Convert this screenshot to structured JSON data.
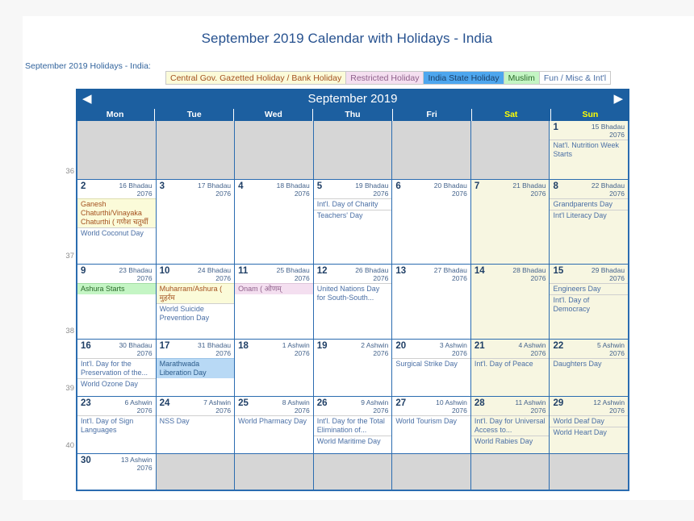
{
  "page": {
    "title": "September 2019 Calendar with Holidays - India",
    "holidays_label": "September 2019 Holidays - India:"
  },
  "legend": {
    "items": [
      {
        "label": "Central Gov. Gazetted Holiday / Bank Holiday",
        "key": "gazetted",
        "bg": "#fbfbd9",
        "fg": "#a4511f"
      },
      {
        "label": "Restricted Holiday",
        "key": "restricted",
        "bg": "#f4dff0",
        "fg": "#8e5f8a"
      },
      {
        "label": "India State Holiday",
        "key": "state",
        "bg": "#4da6ee",
        "fg": "#1b3f67"
      },
      {
        "label": "Muslim",
        "key": "muslim",
        "bg": "#c4f5c4",
        "fg": "#2a6b2a"
      },
      {
        "label": "Fun / Misc & Int'l",
        "key": "fun",
        "bg": "#ffffff",
        "fg": "#4a6fa5"
      }
    ]
  },
  "calendar": {
    "month_title": "September 2019",
    "prev_label": "◀",
    "next_label": "▶",
    "day_headers": [
      {
        "label": "Mon",
        "weekend": false
      },
      {
        "label": "Tue",
        "weekend": false
      },
      {
        "label": "Wed",
        "weekend": false
      },
      {
        "label": "Thu",
        "weekend": false
      },
      {
        "label": "Fri",
        "weekend": false
      },
      {
        "label": "Sat",
        "weekend": true
      },
      {
        "label": "Sun",
        "weekend": true
      }
    ],
    "week_numbers": [
      "36",
      "37",
      "38",
      "39",
      "40"
    ],
    "weeks": [
      {
        "number": "36",
        "days": [
          {
            "blank": true
          },
          {
            "blank": true
          },
          {
            "blank": true
          },
          {
            "blank": true
          },
          {
            "blank": true
          },
          {
            "blank": true
          },
          {
            "num": "1",
            "alt1": "15 Bhadau",
            "alt2": "2076",
            "weekend": true,
            "events": [
              {
                "text": "Nat'l. Nutrition Week Starts",
                "type": "fun"
              }
            ]
          }
        ]
      },
      {
        "number": "37",
        "days": [
          {
            "num": "2",
            "alt1": "16 Bhadau",
            "alt2": "2076",
            "weekend": false,
            "events": [
              {
                "text": "Ganesh Chaturthi/Vinayaka Chaturthi ( गणेश चतुर्थी",
                "type": "gazetted"
              },
              {
                "text": "World Coconut Day",
                "type": "fun"
              }
            ]
          },
          {
            "num": "3",
            "alt1": "17 Bhadau",
            "alt2": "2076",
            "weekend": false,
            "events": []
          },
          {
            "num": "4",
            "alt1": "18 Bhadau",
            "alt2": "2076",
            "weekend": false,
            "events": []
          },
          {
            "num": "5",
            "alt1": "19 Bhadau",
            "alt2": "2076",
            "weekend": false,
            "events": [
              {
                "text": "Int'l. Day of Charity",
                "type": "fun"
              },
              {
                "text": "Teachers' Day",
                "type": "fun"
              }
            ]
          },
          {
            "num": "6",
            "alt1": "20 Bhadau",
            "alt2": "2076",
            "weekend": false,
            "events": []
          },
          {
            "num": "7",
            "alt1": "21 Bhadau",
            "alt2": "2076",
            "weekend": true,
            "events": []
          },
          {
            "num": "8",
            "alt1": "22 Bhadau",
            "alt2": "2076",
            "weekend": true,
            "events": [
              {
                "text": "Grandparents Day",
                "type": "fun"
              },
              {
                "text": "Int'l Literacy Day",
                "type": "fun"
              }
            ]
          }
        ]
      },
      {
        "number": "38",
        "days": [
          {
            "num": "9",
            "alt1": "23 Bhadau",
            "alt2": "2076",
            "weekend": false,
            "events": [
              {
                "text": "Ashura Starts",
                "type": "muslim"
              }
            ]
          },
          {
            "num": "10",
            "alt1": "24 Bhadau",
            "alt2": "2076",
            "weekend": false,
            "events": [
              {
                "text": "Muharram/Ashura ( मुहर्रम",
                "type": "gazetted"
              },
              {
                "text": "World Suicide Prevention Day",
                "type": "fun"
              }
            ]
          },
          {
            "num": "11",
            "alt1": "25 Bhadau",
            "alt2": "2076",
            "weekend": false,
            "events": [
              {
                "text": "Onam ( ओणम्",
                "type": "restricted"
              }
            ]
          },
          {
            "num": "12",
            "alt1": "26 Bhadau",
            "alt2": "2076",
            "weekend": false,
            "events": [
              {
                "text": "United Nations Day for South-South...",
                "type": "fun"
              }
            ]
          },
          {
            "num": "13",
            "alt1": "27 Bhadau",
            "alt2": "2076",
            "weekend": false,
            "events": []
          },
          {
            "num": "14",
            "alt1": "28 Bhadau",
            "alt2": "2076",
            "weekend": true,
            "events": []
          },
          {
            "num": "15",
            "alt1": "29 Bhadau",
            "alt2": "2076",
            "weekend": true,
            "events": [
              {
                "text": "Engineers Day",
                "type": "fun"
              },
              {
                "text": "Int'l. Day of Democracy",
                "type": "fun"
              }
            ]
          }
        ]
      },
      {
        "number": "39",
        "days": [
          {
            "num": "16",
            "alt1": "30 Bhadau",
            "alt2": "2076",
            "weekend": false,
            "events": [
              {
                "text": "Int'l. Day for the Preservation of the...",
                "type": "fun"
              },
              {
                "text": "World Ozone Day",
                "type": "fun"
              }
            ]
          },
          {
            "num": "17",
            "alt1": "31 Bhadau",
            "alt2": "2076",
            "weekend": false,
            "events": [
              {
                "text": "Marathwada Liberation Day",
                "type": "state"
              }
            ]
          },
          {
            "num": "18",
            "alt1": "1 Ashwin",
            "alt2": "2076",
            "weekend": false,
            "events": []
          },
          {
            "num": "19",
            "alt1": "2 Ashwin",
            "alt2": "2076",
            "weekend": false,
            "events": []
          },
          {
            "num": "20",
            "alt1": "3 Ashwin",
            "alt2": "2076",
            "weekend": false,
            "events": [
              {
                "text": "Surgical Strike Day",
                "type": "fun"
              }
            ]
          },
          {
            "num": "21",
            "alt1": "4 Ashwin",
            "alt2": "2076",
            "weekend": true,
            "events": [
              {
                "text": "Int'l. Day of Peace",
                "type": "fun"
              }
            ]
          },
          {
            "num": "22",
            "alt1": "5 Ashwin",
            "alt2": "2076",
            "weekend": true,
            "events": [
              {
                "text": "Daughters Day",
                "type": "fun"
              }
            ]
          }
        ]
      },
      {
        "number": "40",
        "days": [
          {
            "num": "23",
            "alt1": "6 Ashwin",
            "alt2": "2076",
            "weekend": false,
            "events": [
              {
                "text": "Int'l. Day of Sign Languages",
                "type": "fun"
              }
            ]
          },
          {
            "num": "24",
            "alt1": "7 Ashwin",
            "alt2": "2076",
            "weekend": false,
            "events": [
              {
                "text": "NSS Day",
                "type": "fun"
              }
            ]
          },
          {
            "num": "25",
            "alt1": "8 Ashwin",
            "alt2": "2076",
            "weekend": false,
            "events": [
              {
                "text": "World Pharmacy Day",
                "type": "fun"
              }
            ]
          },
          {
            "num": "26",
            "alt1": "9 Ashwin",
            "alt2": "2076",
            "weekend": false,
            "events": [
              {
                "text": "Int'l. Day for the Total Elimination of...",
                "type": "fun"
              },
              {
                "text": "World Maritime Day",
                "type": "fun"
              }
            ]
          },
          {
            "num": "27",
            "alt1": "10 Ashwin",
            "alt2": "2076",
            "weekend": false,
            "events": [
              {
                "text": "World Tourism Day",
                "type": "fun"
              }
            ]
          },
          {
            "num": "28",
            "alt1": "11 Ashwin",
            "alt2": "2076",
            "weekend": true,
            "events": [
              {
                "text": "Int'l. Day for Universal Access to...",
                "type": "fun"
              },
              {
                "text": "World Rabies Day",
                "type": "fun"
              }
            ]
          },
          {
            "num": "29",
            "alt1": "12 Ashwin",
            "alt2": "2076",
            "weekend": true,
            "events": [
              {
                "text": "World Deaf Day",
                "type": "fun"
              },
              {
                "text": "World Heart Day",
                "type": "fun"
              }
            ]
          }
        ]
      },
      {
        "number": "",
        "days": [
          {
            "num": "30",
            "alt1": "13 Ashwin",
            "alt2": "2076",
            "weekend": false,
            "events": []
          },
          {
            "blank": true
          },
          {
            "blank": true
          },
          {
            "blank": true
          },
          {
            "blank": true
          },
          {
            "blank": true
          },
          {
            "blank": true
          }
        ]
      }
    ]
  }
}
